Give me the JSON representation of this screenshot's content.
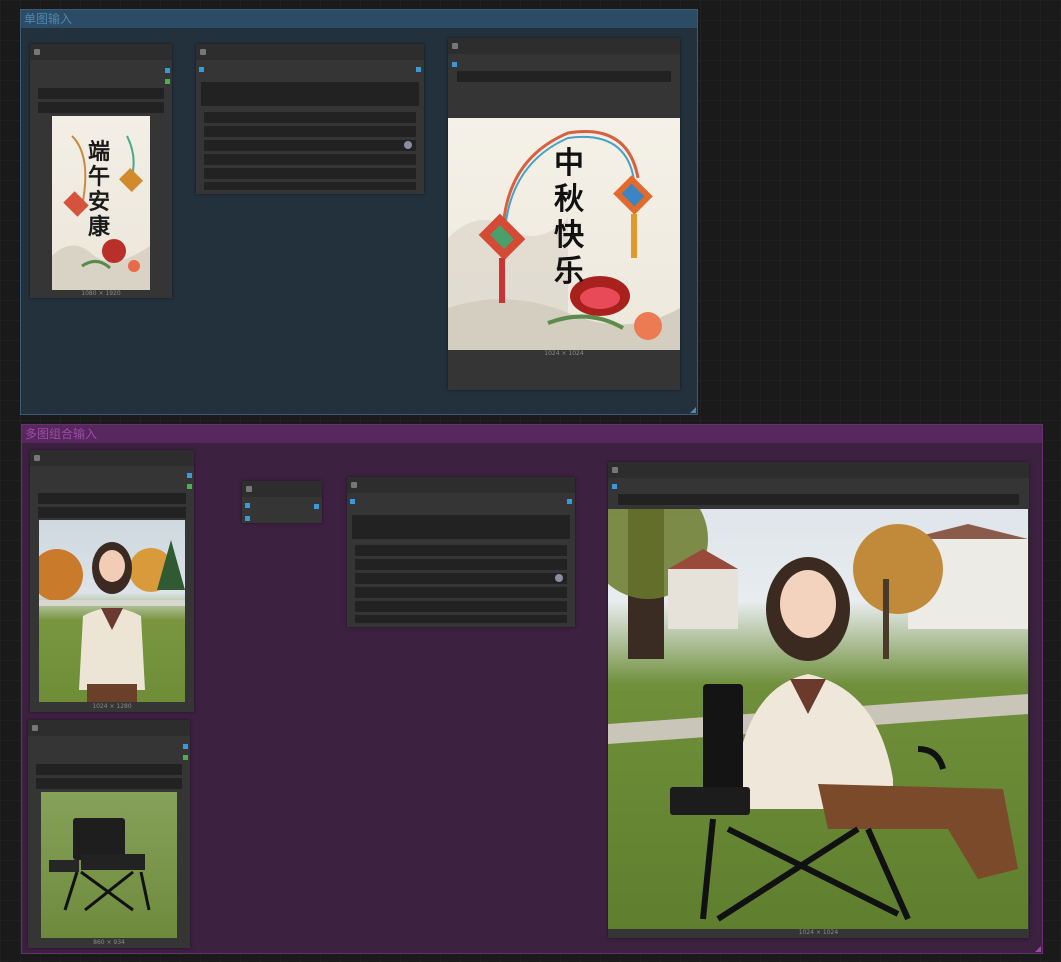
{
  "groups": {
    "single": {
      "title": "单图输入"
    },
    "multi": {
      "title": "多图组合输入"
    }
  },
  "single": {
    "input_image": {
      "poster_text": "端午安康",
      "caption": "1080 × 1920"
    },
    "output_image": {
      "poster_text": "中秋快乐",
      "caption": "1024 × 1024"
    }
  },
  "multi": {
    "input_person": {
      "caption": "1024 × 1280"
    },
    "input_chair": {
      "caption": "860 × 934"
    },
    "output_image": {
      "caption": "1024 × 1024"
    }
  },
  "colors": {
    "wire": "#5aaee8",
    "port_image": "#3a9ad9",
    "port_mask": "#4caf50"
  }
}
